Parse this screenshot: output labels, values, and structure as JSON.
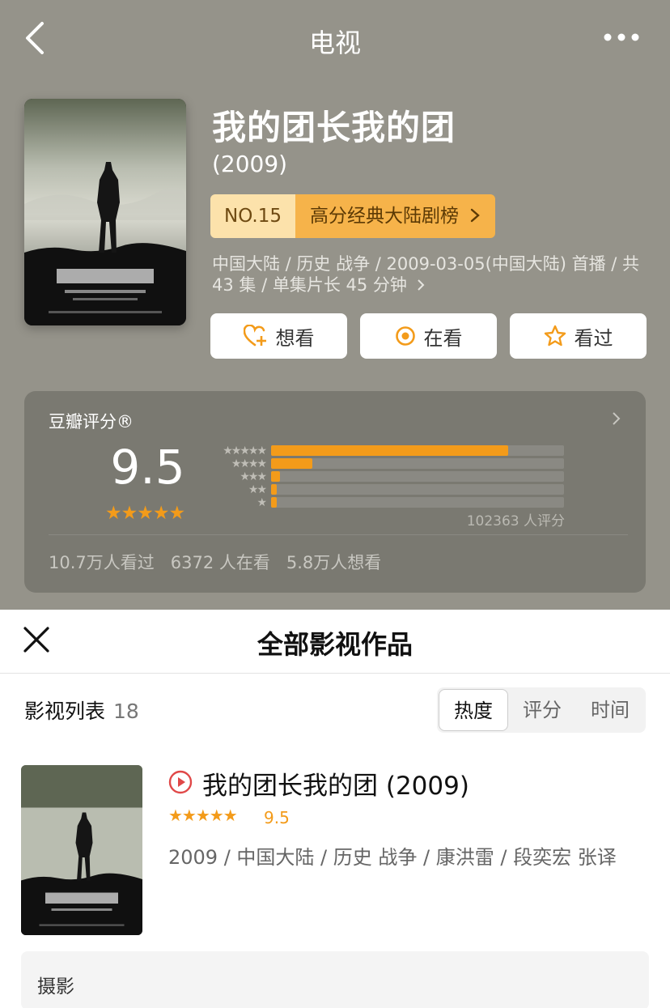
{
  "nav": {
    "title": "电视"
  },
  "subject": {
    "title": "我的团长我的团",
    "year": "(2009)",
    "rank_no": "NO.15",
    "rank_name": "高分经典大陆剧榜",
    "meta": "中国大陆 / 历史 战争 / 2009-03-05(中国大陆) 首播 / 共 43 集 / 单集片长 45 分钟",
    "actions": [
      {
        "label": "想看",
        "icon": "heart-plus-icon"
      },
      {
        "label": "在看",
        "icon": "circle-dot-icon"
      },
      {
        "label": "看过",
        "icon": "star-outline-icon"
      }
    ]
  },
  "rating": {
    "label": "豆瓣评分®",
    "score": "9.5",
    "stars": "★★★★★",
    "distribution": [
      {
        "stars": "★★★★★",
        "fraction": 0.81
      },
      {
        "stars": "★★★★",
        "fraction": 0.14
      },
      {
        "stars": "★★★",
        "fraction": 0.03
      },
      {
        "stars": "★★",
        "fraction": 0.02
      },
      {
        "stars": "★",
        "fraction": 0.02
      }
    ],
    "votes": "102363 人评分",
    "stats": [
      "10.7万人看过",
      "6372 人在看",
      "5.8万人想看"
    ]
  },
  "sheet": {
    "title": "全部影视作品",
    "list_label": "影视列表",
    "count": "18",
    "sort_options": [
      "热度",
      "评分",
      "时间"
    ],
    "items": [
      {
        "title": "我的团长我的团 (2009)",
        "stars": "★★★★★",
        "score": "9.5",
        "meta": "2009 / 中国大陆 / 历史 战争 / 康洪雷 / 段奕宏 张译"
      }
    ],
    "role": "摄影"
  },
  "colors": {
    "accent": "#f39b1a",
    "header_bg": "#95938a",
    "card_bg": "#7a7971"
  }
}
